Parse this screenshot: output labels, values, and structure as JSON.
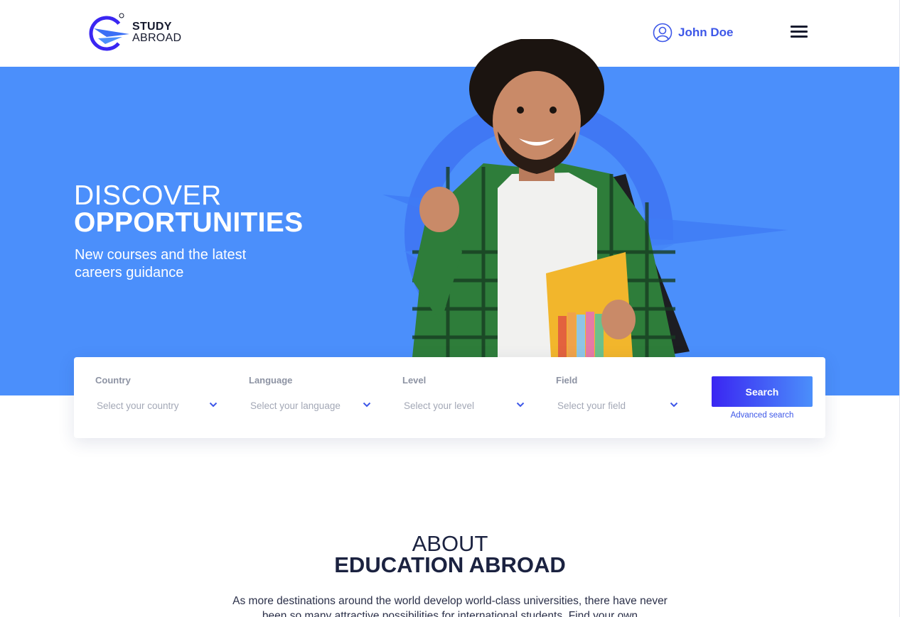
{
  "header": {
    "logo": {
      "line1": "STUDY",
      "line2": "ABROAD",
      "mark": "©"
    },
    "user": {
      "name": "John Doe",
      "icon": "user-circle-icon"
    },
    "menu_icon": "hamburger-menu-icon"
  },
  "hero": {
    "title_line1": "DISCOVER",
    "title_line2": "OPPORTUNITIES",
    "subtitle": "New courses and the latest careers guidance",
    "background_color": "#4b8ffb"
  },
  "search": {
    "fields": [
      {
        "label": "Country",
        "placeholder": "Select your country"
      },
      {
        "label": "Language",
        "placeholder": "Select your language"
      },
      {
        "label": "Level",
        "placeholder": "Select your level"
      },
      {
        "label": "Field",
        "placeholder": "Select your field"
      }
    ],
    "button_label": "Search",
    "advanced_link": "Advanced search",
    "accent_color": "#3d57e8"
  },
  "about": {
    "title_line1": "ABOUT",
    "title_line2": "EDUCATION ABROAD",
    "text": "As more destinations around the world develop world-class universities, there have never been so many attractive possibilities for international students. Find your own"
  }
}
